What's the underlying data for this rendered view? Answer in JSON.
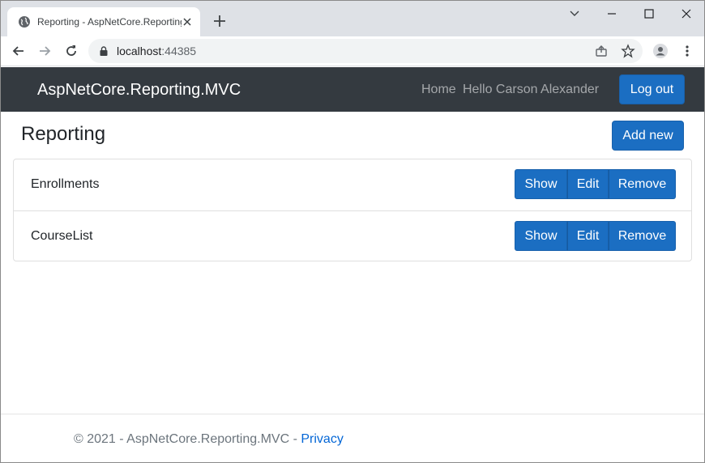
{
  "browser": {
    "tab_title": "Reporting - AspNetCore.Reporting.MVC",
    "url_host": "localhost",
    "url_port": ":44385"
  },
  "navbar": {
    "brand": "AspNetCore.Reporting.MVC",
    "home": "Home",
    "greeting": "Hello Carson Alexander",
    "logout_label": "Log out"
  },
  "page": {
    "title": "Reporting",
    "add_new_label": "Add new",
    "reports": [
      {
        "name": "Enrollments",
        "show": "Show",
        "edit": "Edit",
        "remove": "Remove"
      },
      {
        "name": "CourseList",
        "show": "Show",
        "edit": "Edit",
        "remove": "Remove"
      }
    ]
  },
  "footer": {
    "copyright": "© 2021 - AspNetCore.Reporting.MVC - ",
    "privacy": "Privacy"
  },
  "colors": {
    "navbar_bg": "#343a40",
    "primary": "#1b6ec2",
    "link": "#0366d6"
  }
}
